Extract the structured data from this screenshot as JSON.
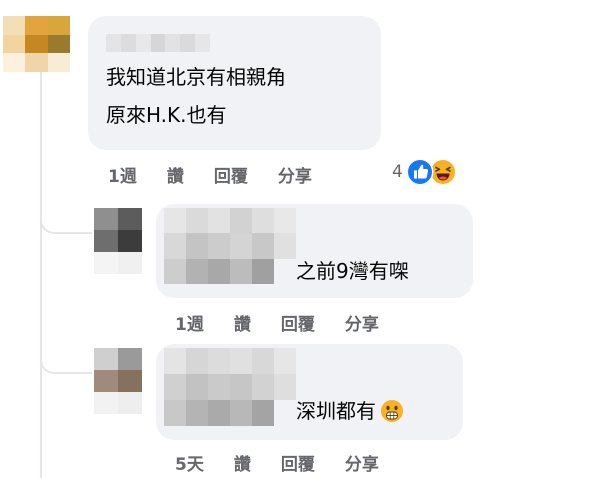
{
  "comments": [
    {
      "text_lines": [
        "我知道北京有相親角",
        "原來H.K.也有"
      ],
      "time": "1週",
      "like_label": "讚",
      "reply_label": "回覆",
      "share_label": "分享",
      "reaction_count": "4",
      "reactions": [
        "like-icon",
        "laugh-icon"
      ]
    },
    {
      "text": "之前9灣有㗎",
      "time": "1週",
      "like_label": "讚",
      "reply_label": "回覆",
      "share_label": "分享"
    },
    {
      "text": "深圳都有",
      "emoji": "astonished-face-icon",
      "time": "5天",
      "like_label": "讚",
      "reply_label": "回覆",
      "share_label": "分享"
    }
  ],
  "colors": {
    "bubble": "#f0f2f5",
    "meta_text": "#65676b",
    "like_blue": "#1877f2",
    "emoji_yellow": "#f7b125",
    "thread_line": "#e4e6eb"
  }
}
